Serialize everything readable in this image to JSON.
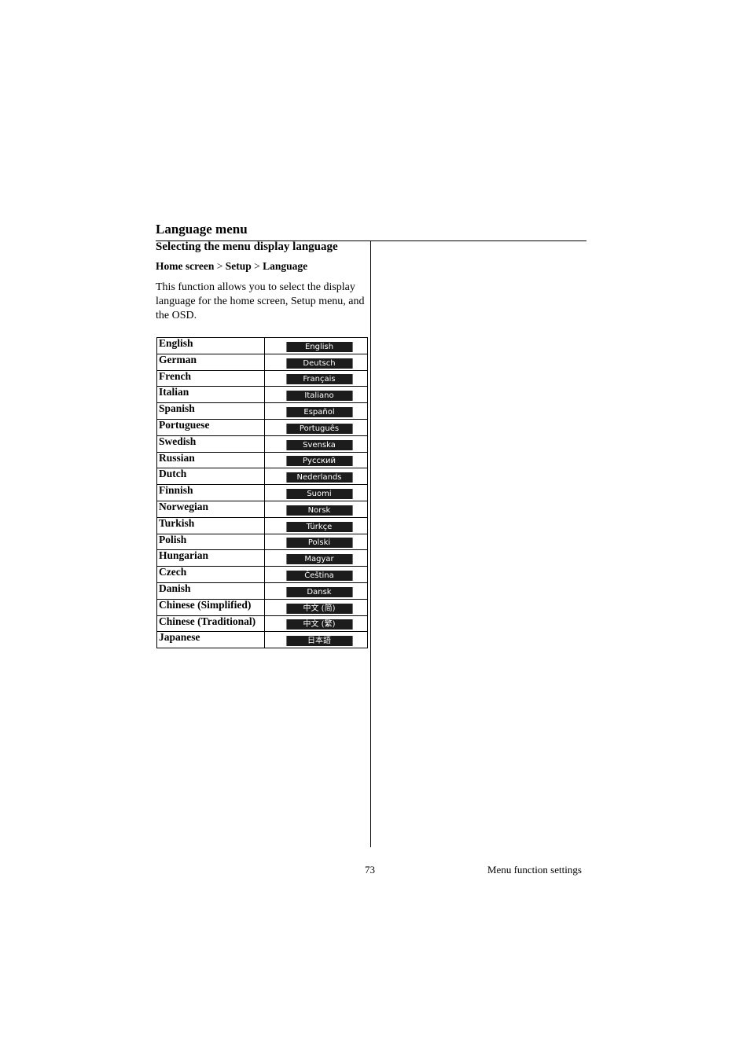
{
  "section_title": "Language menu",
  "subtitle": "Selecting the menu display language",
  "breadcrumb": {
    "items": [
      "Home screen",
      "Setup",
      "Language"
    ],
    "separator": ">"
  },
  "description": "This function allows you to select the display language for the home screen, Setup menu, and the OSD.",
  "languages": [
    {
      "name": "English",
      "osd": "English"
    },
    {
      "name": "German",
      "osd": "Deutsch"
    },
    {
      "name": "French",
      "osd": "Français"
    },
    {
      "name": "Italian",
      "osd": "Italiano"
    },
    {
      "name": "Spanish",
      "osd": "Español"
    },
    {
      "name": "Portuguese",
      "osd": "Português"
    },
    {
      "name": "Swedish",
      "osd": "Svenska"
    },
    {
      "name": "Russian",
      "osd": "Русский"
    },
    {
      "name": "Dutch",
      "osd": "Nederlands"
    },
    {
      "name": "Finnish",
      "osd": "Suomi"
    },
    {
      "name": "Norwegian",
      "osd": "Norsk"
    },
    {
      "name": "Turkish",
      "osd": "Türkçe"
    },
    {
      "name": "Polish",
      "osd": "Polski"
    },
    {
      "name": "Hungarian",
      "osd": "Magyar"
    },
    {
      "name": "Czech",
      "osd": "Čeština"
    },
    {
      "name": "Danish",
      "osd": "Dansk"
    },
    {
      "name": "Chinese (Simplified)",
      "osd": "中文 (简)"
    },
    {
      "name": "Chinese (Traditional)",
      "osd": "中文 (繁)"
    },
    {
      "name": "Japanese",
      "osd": "日本語"
    }
  ],
  "colors": {
    "osd_background": "#1c1c1c",
    "osd_text": "#ffffff"
  },
  "footer": {
    "page_number": "73",
    "chapter_title": "Menu function settings"
  }
}
